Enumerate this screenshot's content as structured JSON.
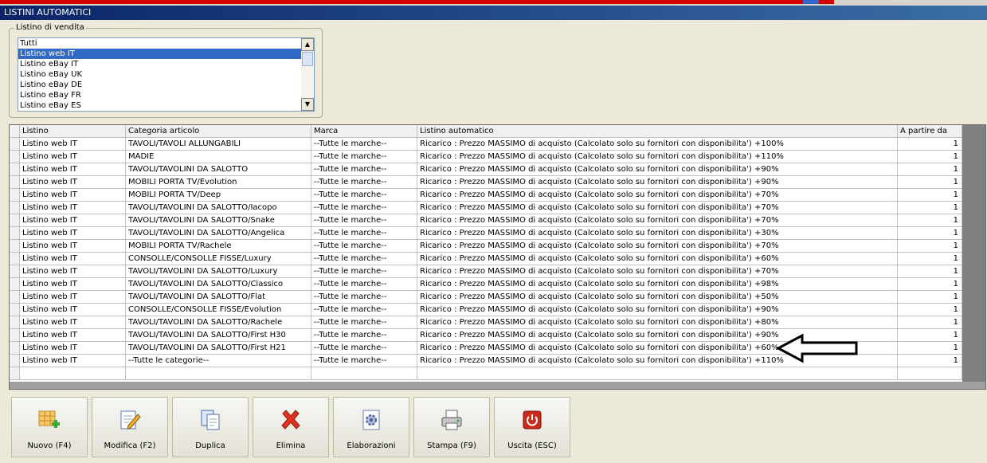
{
  "window": {
    "title": "LISTINI AUTOMATICI"
  },
  "listino_group": {
    "legend": "Listino di vendita",
    "items": [
      "Tutti",
      "Listino web IT",
      "Listino eBay IT",
      "Listino eBay UK",
      "Listino eBay DE",
      "Listino eBay FR",
      "Listino eBay ES"
    ],
    "selected": "Listino web IT"
  },
  "table": {
    "columns": [
      "Listino",
      "Categoria articolo",
      "Marca",
      "Listino automatico",
      "A partire da"
    ],
    "rows": [
      [
        "Listino web IT",
        "TAVOLI/TAVOLI ALLUNGABILI",
        "--Tutte le marche--",
        "Ricarico : Prezzo MASSIMO di acquisto (Calcolato solo su fornitori con disponibilita') +100%",
        "1"
      ],
      [
        "Listino web IT",
        "MADIE",
        "--Tutte le marche--",
        "Ricarico : Prezzo MASSIMO di acquisto (Calcolato solo su fornitori con disponibilita') +110%",
        "1"
      ],
      [
        "Listino web IT",
        "TAVOLI/TAVOLINI DA SALOTTO",
        "--Tutte le marche--",
        "Ricarico : Prezzo MASSIMO di acquisto (Calcolato solo su fornitori con disponibilita') +90%",
        "1"
      ],
      [
        "Listino web IT",
        "MOBILI PORTA TV/Evolution",
        "--Tutte le marche--",
        "Ricarico : Prezzo MASSIMO di acquisto (Calcolato solo su fornitori con disponibilita') +90%",
        "1"
      ],
      [
        "Listino web IT",
        "MOBILI PORTA TV/Deep",
        "--Tutte le marche--",
        "Ricarico : Prezzo MASSIMO di acquisto (Calcolato solo su fornitori con disponibilita') +70%",
        "1"
      ],
      [
        "Listino web IT",
        "TAVOLI/TAVOLINI DA SALOTTO/Iacopo",
        "--Tutte le marche--",
        "Ricarico : Prezzo MASSIMO di acquisto (Calcolato solo su fornitori con disponibilita') +70%",
        "1"
      ],
      [
        "Listino web IT",
        "TAVOLI/TAVOLINI DA SALOTTO/Snake",
        "--Tutte le marche--",
        "Ricarico : Prezzo MASSIMO di acquisto (Calcolato solo su fornitori con disponibilita') +70%",
        "1"
      ],
      [
        "Listino web IT",
        "TAVOLI/TAVOLINI DA SALOTTO/Angelica",
        "--Tutte le marche--",
        "Ricarico : Prezzo MASSIMO di acquisto (Calcolato solo su fornitori con disponibilita') +30%",
        "1"
      ],
      [
        "Listino web IT",
        "MOBILI PORTA TV/Rachele",
        "--Tutte le marche--",
        "Ricarico : Prezzo MASSIMO di acquisto (Calcolato solo su fornitori con disponibilita') +70%",
        "1"
      ],
      [
        "Listino web IT",
        "CONSOLLE/CONSOLLE FISSE/Luxury",
        "--Tutte le marche--",
        "Ricarico : Prezzo MASSIMO di acquisto (Calcolato solo su fornitori con disponibilita') +60%",
        "1"
      ],
      [
        "Listino web IT",
        "TAVOLI/TAVOLINI DA SALOTTO/Luxury",
        "--Tutte le marche--",
        "Ricarico : Prezzo MASSIMO di acquisto (Calcolato solo su fornitori con disponibilita') +70%",
        "1"
      ],
      [
        "Listino web IT",
        "TAVOLI/TAVOLINI DA SALOTTO/Classico",
        "--Tutte le marche--",
        "Ricarico : Prezzo MASSIMO di acquisto (Calcolato solo su fornitori con disponibilita') +98%",
        "1"
      ],
      [
        "Listino web IT",
        "TAVOLI/TAVOLINI DA SALOTTO/Flat",
        "--Tutte le marche--",
        "Ricarico : Prezzo MASSIMO di acquisto (Calcolato solo su fornitori con disponibilita') +50%",
        "1"
      ],
      [
        "Listino web IT",
        "CONSOLLE/CONSOLLE FISSE/Evolution",
        "--Tutte le marche--",
        "Ricarico : Prezzo MASSIMO di acquisto (Calcolato solo su fornitori con disponibilita') +90%",
        "1"
      ],
      [
        "Listino web IT",
        "TAVOLI/TAVOLINI DA SALOTTO/Rachele",
        "--Tutte le marche--",
        "Ricarico : Prezzo MASSIMO di acquisto (Calcolato solo su fornitori con disponibilita') +80%",
        "1"
      ],
      [
        "Listino web IT",
        "TAVOLI/TAVOLINI DA SALOTTO/First H30",
        "--Tutte le marche--",
        "Ricarico : Prezzo MASSIMO di acquisto (Calcolato solo su fornitori con disponibilita') +90%",
        "1"
      ],
      [
        "Listino web IT",
        "TAVOLI/TAVOLINI DA SALOTTO/First H21",
        "--Tutte le marche--",
        "Ricarico : Prezzo MASSIMO di acquisto (Calcolato solo su fornitori con disponibilita') +60%",
        "1"
      ],
      [
        "Listino web IT",
        "--Tutte le categorie--",
        "--Tutte le marche--",
        "Ricarico : Prezzo MASSIMO di acquisto (Calcolato solo su fornitori con disponibilita') +110%",
        "1"
      ]
    ]
  },
  "toolbar": {
    "buttons": [
      {
        "label": "Nuovo (F4)",
        "icon": "new-grid-icon"
      },
      {
        "label": "Modifica (F2)",
        "icon": "edit-pencil-icon"
      },
      {
        "label": "Duplica",
        "icon": "duplicate-icon"
      },
      {
        "label": "Elimina",
        "icon": "delete-x-icon"
      },
      {
        "label": "Elaborazioni",
        "icon": "process-gear-icon"
      },
      {
        "label": "Stampa (F9)",
        "icon": "printer-icon"
      },
      {
        "label": "Uscita (ESC)",
        "icon": "exit-power-icon"
      }
    ]
  },
  "colors": {
    "selection": "#316ac5",
    "titlebar": "#0a246a",
    "delete": "#e03020",
    "exit": "#cc2a1a"
  }
}
